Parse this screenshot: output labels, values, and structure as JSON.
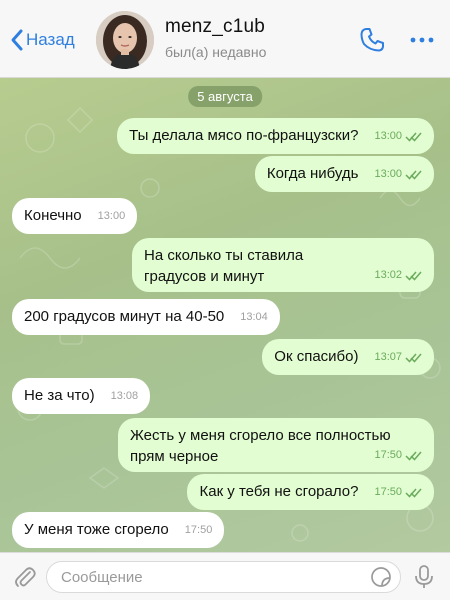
{
  "header": {
    "back_label": "Назад",
    "contact_name": "menz_c1ub",
    "status": "был(а) недавно"
  },
  "chat": {
    "date": "5 августа",
    "messages": [
      {
        "dir": "out",
        "text": "Ты делала мясо по-французски?",
        "time": "13:00",
        "read": true
      },
      {
        "dir": "out",
        "text": "Когда нибудь",
        "time": "13:00",
        "read": true
      },
      {
        "dir": "in",
        "text": "Конечно",
        "time": "13:00"
      },
      {
        "dir": "out",
        "text": "На сколько ты ставила градусов и минут",
        "time": "13:02",
        "read": true
      },
      {
        "dir": "in",
        "text": "200 градусов минут на 40-50",
        "time": "13:04"
      },
      {
        "dir": "out",
        "text": "Ок спасибо)",
        "time": "13:07",
        "read": true
      },
      {
        "dir": "in",
        "text": "Не за что)",
        "time": "13:08"
      },
      {
        "dir": "out",
        "text": "Жесть у меня сгорело все полностью прям черное",
        "time": "17:50",
        "read": true
      },
      {
        "dir": "out",
        "text": "Как у тебя не сгорало?",
        "time": "17:50",
        "read": true
      },
      {
        "dir": "in",
        "text": "У меня тоже сгорело",
        "time": "17:50"
      }
    ]
  },
  "input": {
    "placeholder": "Сообщение",
    "value": ""
  },
  "icons": {
    "back": "chevron-left-icon",
    "call": "phone-icon",
    "more": "more-dots-icon",
    "attach": "paperclip-icon",
    "sticker": "sticker-icon",
    "mic": "microphone-icon",
    "read": "double-check-icon"
  },
  "colors": {
    "accent": "#2f7fe0",
    "outgoing_bubble": "#e2fdd1",
    "incoming_bubble": "#ffffff",
    "outgoing_time": "#6bab5d",
    "chat_background": "#a9c38f"
  }
}
